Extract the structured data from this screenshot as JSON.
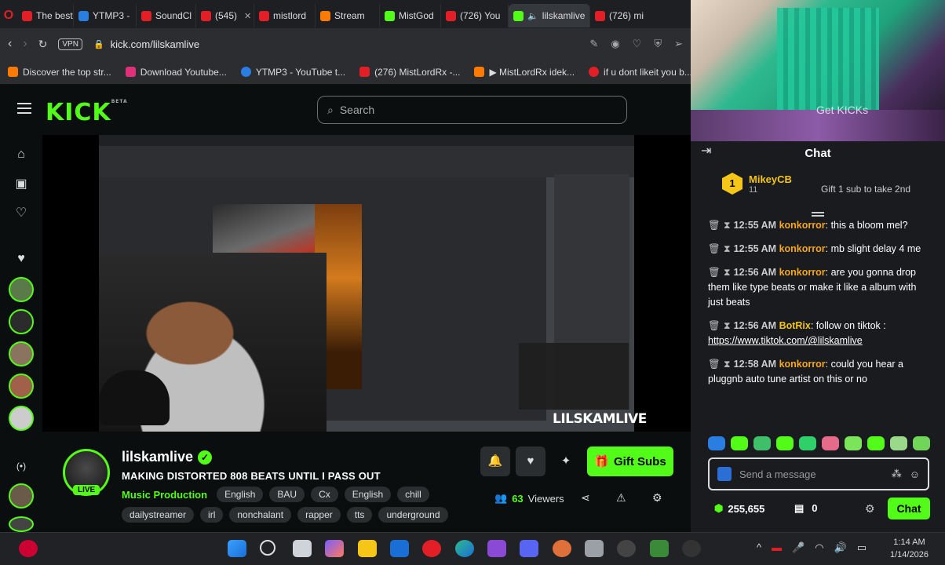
{
  "browser": {
    "tabs": [
      {
        "label": "The best",
        "icon": "opera-icon",
        "color": "#e21f26"
      },
      {
        "label": "YTMP3 -",
        "icon": "ytmp3-icon",
        "color": "#2a7de1"
      },
      {
        "label": "SoundCl",
        "icon": "youtube-icon",
        "color": "#e21f26"
      },
      {
        "label": "(545)",
        "icon": "youtube-icon",
        "color": "#e21f26"
      },
      {
        "label": "mistlord",
        "icon": "youtube-icon",
        "color": "#e21f26"
      },
      {
        "label": "Stream",
        "icon": "amazon-icon",
        "color": "#ff7a00"
      },
      {
        "label": "MistGod",
        "icon": "kick-icon",
        "color": "#53fc18"
      },
      {
        "label": "(726) You",
        "icon": "youtube-icon",
        "color": "#e21f26"
      },
      {
        "label": "lilskamlive",
        "icon": "kick-icon",
        "color": "#53fc18"
      },
      {
        "label": "(726) mi",
        "icon": "youtube-icon",
        "color": "#e21f26"
      }
    ],
    "vpn_label": "VPN",
    "url": "kick.com/lilskamlive",
    "bookmarks": [
      {
        "label": "Discover the top str...",
        "color": "#ff7a00"
      },
      {
        "label": "Download Youtube...",
        "color": "#e0307a"
      },
      {
        "label": "YTMP3 - YouTube t...",
        "color": "#2a7de1"
      },
      {
        "label": "(276) MistLordRx -...",
        "color": "#e21f26"
      },
      {
        "label": "▶ MistLordRx idek...",
        "color": "#ff7a00"
      },
      {
        "label": "if u dont likeit you b...",
        "color": "#e21f26"
      }
    ]
  },
  "webcam": {
    "overlay_text": "Get KICKs"
  },
  "kick": {
    "logo": "KICK",
    "logo_badge": "BETA",
    "search_placeholder": "Search",
    "video_watermark": "LILSKAMLIVE"
  },
  "stream": {
    "name": "lilskamlive",
    "live_badge": "LIVE",
    "title": "MAKING DISTORTED 808 BEATS UNTIL I PASS OUT",
    "category": "Music Production",
    "tags_row1": [
      "English",
      "BAU",
      "Cx",
      "English",
      "chill"
    ],
    "tags_row2": [
      "dailystreamer",
      "irl",
      "nonchalant",
      "rapper",
      "tts",
      "underground"
    ],
    "gift_button": "Gift Subs",
    "viewers_count": "63",
    "viewers_label": "Viewers"
  },
  "chat": {
    "title": "Chat",
    "pinned": {
      "rank": "1",
      "user": "MikeyCB",
      "count": "11",
      "gift_text": "Gift 1 sub to take 2nd"
    },
    "messages": [
      {
        "time": "12:55 AM",
        "user": "konkorror",
        "user_color": "#f5a623",
        "text": "this a bloom mel?"
      },
      {
        "time": "12:55 AM",
        "user": "konkorror",
        "user_color": "#f5a623",
        "text": "mb slight delay 4 me"
      },
      {
        "time": "12:56 AM",
        "user": "konkorror",
        "user_color": "#f5a623",
        "text": "are you gonna drop them like type beats or make it like a album with just beats"
      },
      {
        "time": "12:56 AM",
        "user": "BotRix",
        "user_color": "#f5c518",
        "text": "follow on tiktok : ",
        "link": "https://www.tiktok.com/@lilskamlive"
      },
      {
        "time": "12:58 AM",
        "user": "konkorror",
        "user_color": "#f5a623",
        "text": "could you hear a pluggnb auto tune artist on this or no"
      }
    ],
    "input_placeholder": "Send a message",
    "points": "255,655",
    "tickets": "0",
    "chat_button": "Chat"
  },
  "taskbar": {
    "time": "1:14 AM",
    "date": "1/14/2026"
  }
}
